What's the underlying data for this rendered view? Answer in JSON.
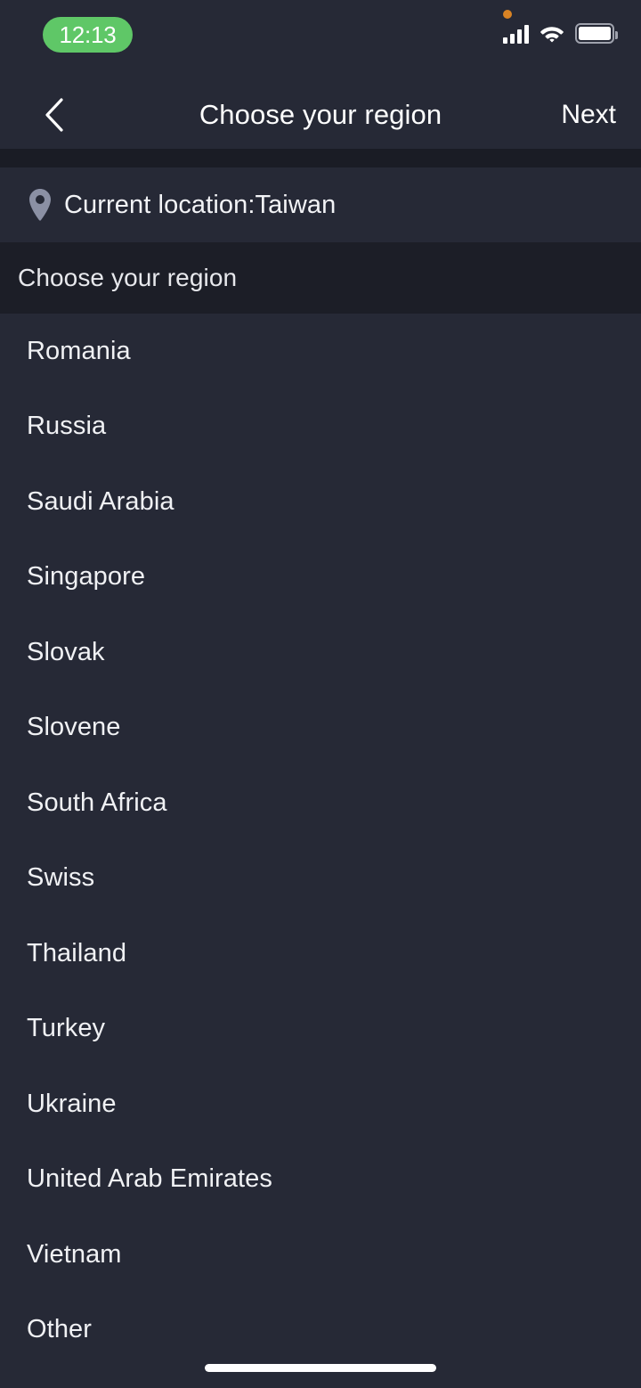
{
  "status_bar": {
    "time": "12:13",
    "time_pill_color": "#5fc767",
    "privacy_dot_color": "#d98324",
    "icons": {
      "cellular": "signal-bars-icon",
      "wifi": "wifi-icon",
      "battery": "battery-full-icon"
    }
  },
  "nav_bar": {
    "back_icon": "chevron-left-icon",
    "title": "Choose your region",
    "next_label": "Next"
  },
  "location": {
    "icon": "location-pin-icon",
    "text": "Current location:Taiwan"
  },
  "section": {
    "header": "Choose your region"
  },
  "regions": [
    {
      "name": "Romania"
    },
    {
      "name": "Russia"
    },
    {
      "name": "Saudi Arabia"
    },
    {
      "name": "Singapore"
    },
    {
      "name": "Slovak"
    },
    {
      "name": "Slovene"
    },
    {
      "name": "South Africa"
    },
    {
      "name": "Swiss"
    },
    {
      "name": "Thailand"
    },
    {
      "name": "Turkey"
    },
    {
      "name": "Ukraine"
    },
    {
      "name": "United Arab Emirates"
    },
    {
      "name": "Vietnam"
    },
    {
      "name": "Other"
    }
  ],
  "home_indicator": "home-indicator-bar",
  "theme": {
    "background": "#262936",
    "background_dark": "#1c1e27",
    "text_primary": "#f0f1f4",
    "accent_green": "#5fc767",
    "pin_gray": "#8b90a4"
  }
}
